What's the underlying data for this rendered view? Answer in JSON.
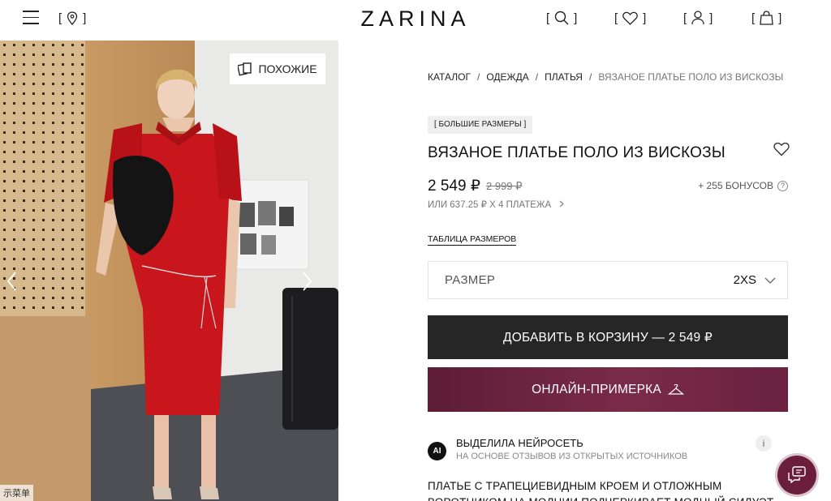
{
  "header": {
    "logo": "ZARINA",
    "icons": [
      "menu-icon",
      "location-icon",
      "search-icon",
      "heart-icon",
      "user-icon",
      "bag-icon"
    ]
  },
  "gallery": {
    "similar_label": "ПОХОЖИЕ",
    "watermark": "示菜单"
  },
  "breadcrumb": [
    "КАТАЛОГ",
    "ОДЕЖДА",
    "ПЛАТЬЯ",
    "ВЯЗАНОЕ ПЛАТЬЕ ПОЛО ИЗ ВИСКОЗЫ"
  ],
  "product": {
    "badge": "[ БОЛЬШИЕ РАЗМЕРЫ ]",
    "title": "ВЯЗАНОЕ ПЛАТЬЕ ПОЛО ИЗ ВИСКОЗЫ",
    "price": "2 549 ₽",
    "old_price": "2 999 ₽",
    "bonus": "+ 255 БОНУСОВ",
    "installments": "ИЛИ 637.25 ₽ X 4 ПЛАТЕЖА",
    "size_table_link": "ТАБЛИЦА РАЗМЕРОВ",
    "size_label": "РАЗМЕР",
    "size_value": "2XS",
    "add_to_cart": "ДОБАВИТЬ В КОРЗИНУ — 2 549 ₽",
    "try_on": "ОНЛАЙН-ПРИМЕРКА"
  },
  "ai": {
    "badge": "AI",
    "title": "ВЫДЕЛИЛА НЕЙРОСЕТЬ",
    "subtitle": "НА ОСНОВЕ ОТЗЫВОВ ИЗ ОТКРЫТЫХ ИСТОЧНИКОВ",
    "info": "i",
    "description": "ПЛАТЬЕ С ТРАПЕЦИЕВИДНЫМ КРОЕМ И ОТЛОЖНЫМ ВОРОТНИКОМ НА МОЛНИИ ПОДЧЕРКИВАЕТ МОДНЫЙ СИЛУЭТ"
  },
  "colors": {
    "dark_button": "#262626",
    "tryon_button": "#6a2240",
    "dress_red": "#c8161c"
  }
}
